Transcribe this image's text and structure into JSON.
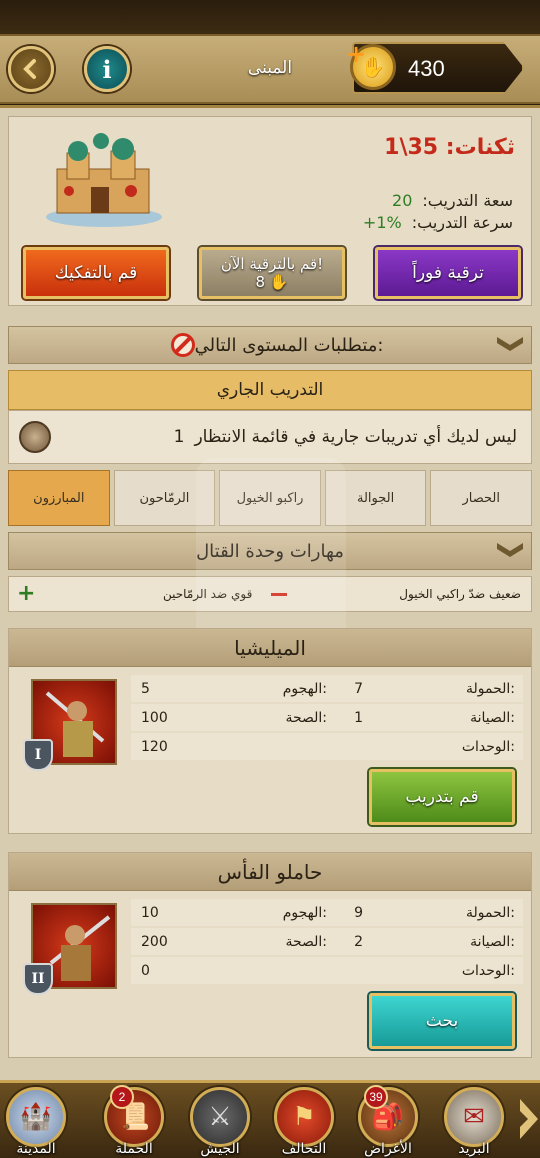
{
  "header": {
    "title": "المبنى",
    "gold": "430",
    "icons": [
      "back-arrow-icon",
      "info-icon",
      "gold-coin-icon",
      "plus-icon"
    ]
  },
  "building": {
    "level": "ثكنات: 35\\1",
    "capacity_label": "سعة التدريب:",
    "capacity_value": "20",
    "speed_label": "سرعة التدريب:",
    "speed_value": "+1%",
    "instant_upgrade": "ترقية فوراً",
    "upgrade_now": "قم بالترقية الآن!",
    "upgrade_now_cost": "8",
    "dismantle": "قم بالتفكيك"
  },
  "requirements": {
    "label": "متطلبات المستوى التالي:"
  },
  "training": {
    "header": "التدريب الجاري",
    "message": "ليس لديك أي تدريبات جارية في قائمة الانتظار",
    "queue_count": "1"
  },
  "tabs": [
    {
      "label": "الحصار",
      "active": false
    },
    {
      "label": "الجوالة",
      "active": false
    },
    {
      "label": "راكبو الخيول",
      "active": false
    },
    {
      "label": "الرمّاحون",
      "active": false
    },
    {
      "label": "المبارزون",
      "active": true
    }
  ],
  "combat_skills": {
    "title": "مهارات وحدة القتال",
    "weak": "ضعيف ضدّ راكبي الخيول",
    "strong": "قوي ضد الرمّاحين"
  },
  "units": [
    {
      "name": "الميليشيا",
      "tier": "I",
      "load_label": "الحمولة:",
      "load": "7",
      "attack_label": "الهجوم:",
      "attack": "5",
      "upkeep_label": "الصيانة:",
      "upkeep": "1",
      "health_label": "الصحة:",
      "health": "100",
      "units_label": "الوحدات:",
      "units": "120",
      "button": "قم بتدريب"
    },
    {
      "name": "حاملو الفأس",
      "tier": "II",
      "load_label": "الحمولة:",
      "load": "9",
      "attack_label": "الهجوم:",
      "attack": "10",
      "upkeep_label": "الصيانة:",
      "upkeep": "2",
      "health_label": "الصحة:",
      "health": "200",
      "units_label": "الوحدات:",
      "units": "0",
      "button": "بحث"
    }
  ],
  "bottom_nav": [
    {
      "label": "المدينة",
      "badge": "",
      "icon": "city-icon"
    },
    {
      "label": "الحملة",
      "badge": "2",
      "icon": "campaign-icon"
    },
    {
      "label": "الجيش",
      "badge": "",
      "icon": "army-swords-icon"
    },
    {
      "label": "التحالف",
      "badge": "",
      "icon": "alliance-banner-icon"
    },
    {
      "label": "الأغراض",
      "badge": "39",
      "icon": "items-bag-icon"
    },
    {
      "label": "البريد",
      "badge": "",
      "icon": "mail-icon"
    }
  ],
  "colors": {
    "level": "#c42a1a",
    "positive": "#2e7d23",
    "active_tab": "#e5a84c",
    "train": "#6aa82e",
    "research": "#2ab8b4"
  }
}
